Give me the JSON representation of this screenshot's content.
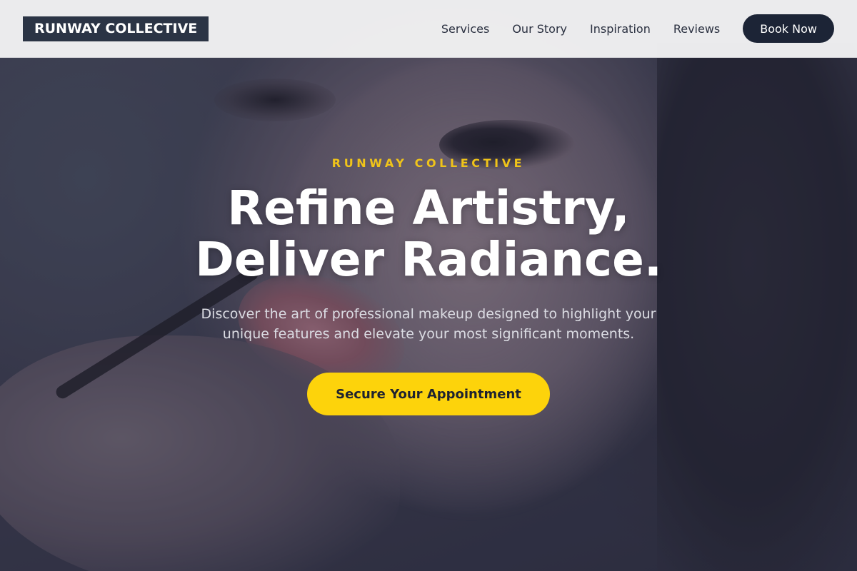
{
  "header": {
    "logo": "RUNWAY COLLECTIVE",
    "nav": [
      "Services",
      "Our Story",
      "Inspiration",
      "Reviews"
    ],
    "book_label": "Book Now"
  },
  "hero": {
    "eyebrow": "RUNWAY COLLECTIVE",
    "headline_line1": "Refine Artistry,",
    "headline_line2": "Deliver Radiance.",
    "subtext": "Discover the art of professional makeup designed to highlight your unique features and elevate your most significant moments.",
    "cta_label": "Secure Your Appointment",
    "background_image": "makeup-application-photo"
  },
  "colors": {
    "accent": "#fdd30b",
    "header_bg": "#f3f3f4",
    "logo_bg": "#2b3445",
    "book_button_bg": "#1c2436",
    "eyebrow": "#f0c419"
  }
}
